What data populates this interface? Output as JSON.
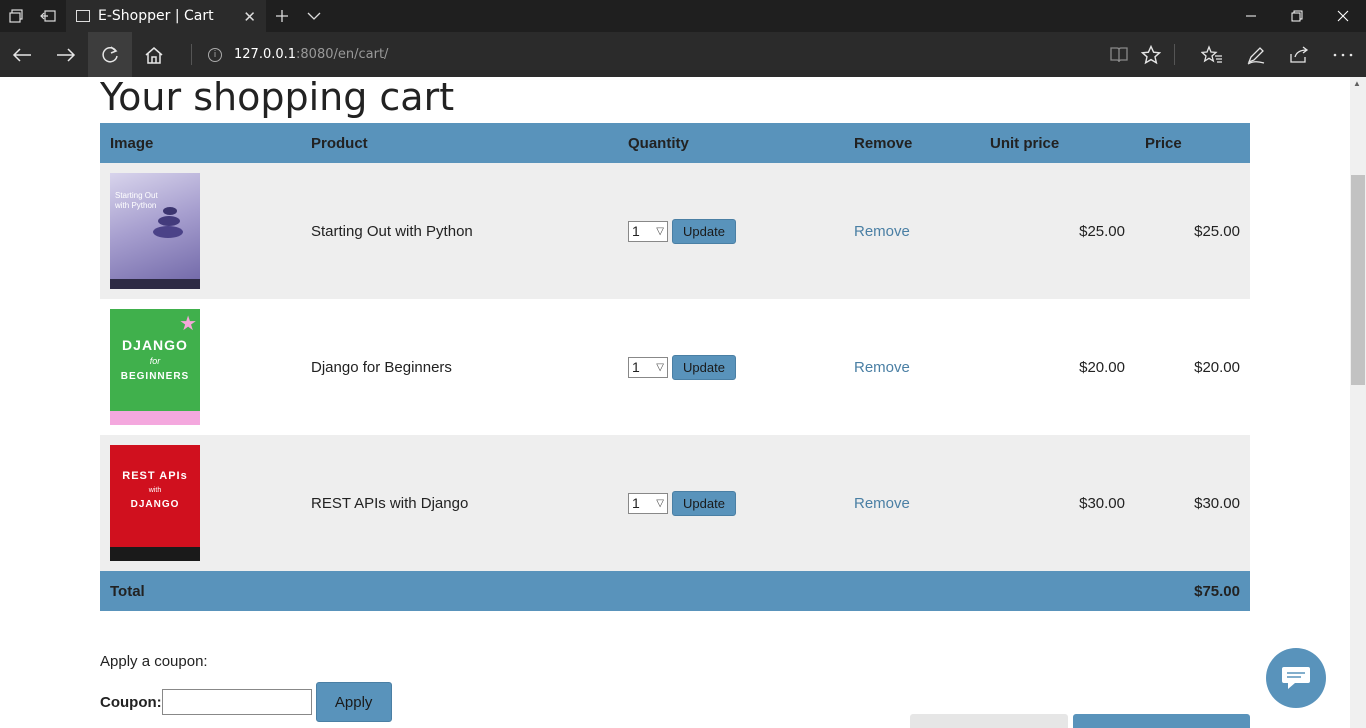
{
  "browser": {
    "tab_title": "E-Shopper | Cart",
    "url_host": "127.0.0.1",
    "url_path": ":8080/en/cart/"
  },
  "cart": {
    "title": "Your shopping cart",
    "headers": {
      "image": "Image",
      "product": "Product",
      "quantity": "Quantity",
      "remove": "Remove",
      "unit_price": "Unit price",
      "price": "Price"
    },
    "items": [
      {
        "product": "Starting Out with Python",
        "quantity": "1",
        "update_label": "Update",
        "remove_label": "Remove",
        "unit_price": "$25.00",
        "price": "$25.00",
        "cover": {
          "line1": "Starting Out",
          "line2": "with Python"
        }
      },
      {
        "product": "Django for Beginners",
        "quantity": "1",
        "update_label": "Update",
        "remove_label": "Remove",
        "unit_price": "$20.00",
        "price": "$20.00",
        "cover": {
          "line1": "DJANGO",
          "line2": "for",
          "line3": "BEGINNERS"
        }
      },
      {
        "product": "REST APIs with Django",
        "quantity": "1",
        "update_label": "Update",
        "remove_label": "Remove",
        "unit_price": "$30.00",
        "price": "$30.00",
        "cover": {
          "line1": "REST APIs",
          "line2": "with",
          "line3": "DJANGO"
        }
      }
    ],
    "total_label": "Total",
    "total_value": "$75.00"
  },
  "coupon": {
    "prompt": "Apply a coupon:",
    "label": "Coupon:",
    "value": "",
    "apply_label": "Apply"
  },
  "colors": {
    "accent": "#5993bb",
    "row_alt": "#eeeeee",
    "link": "#4a7fa4"
  }
}
